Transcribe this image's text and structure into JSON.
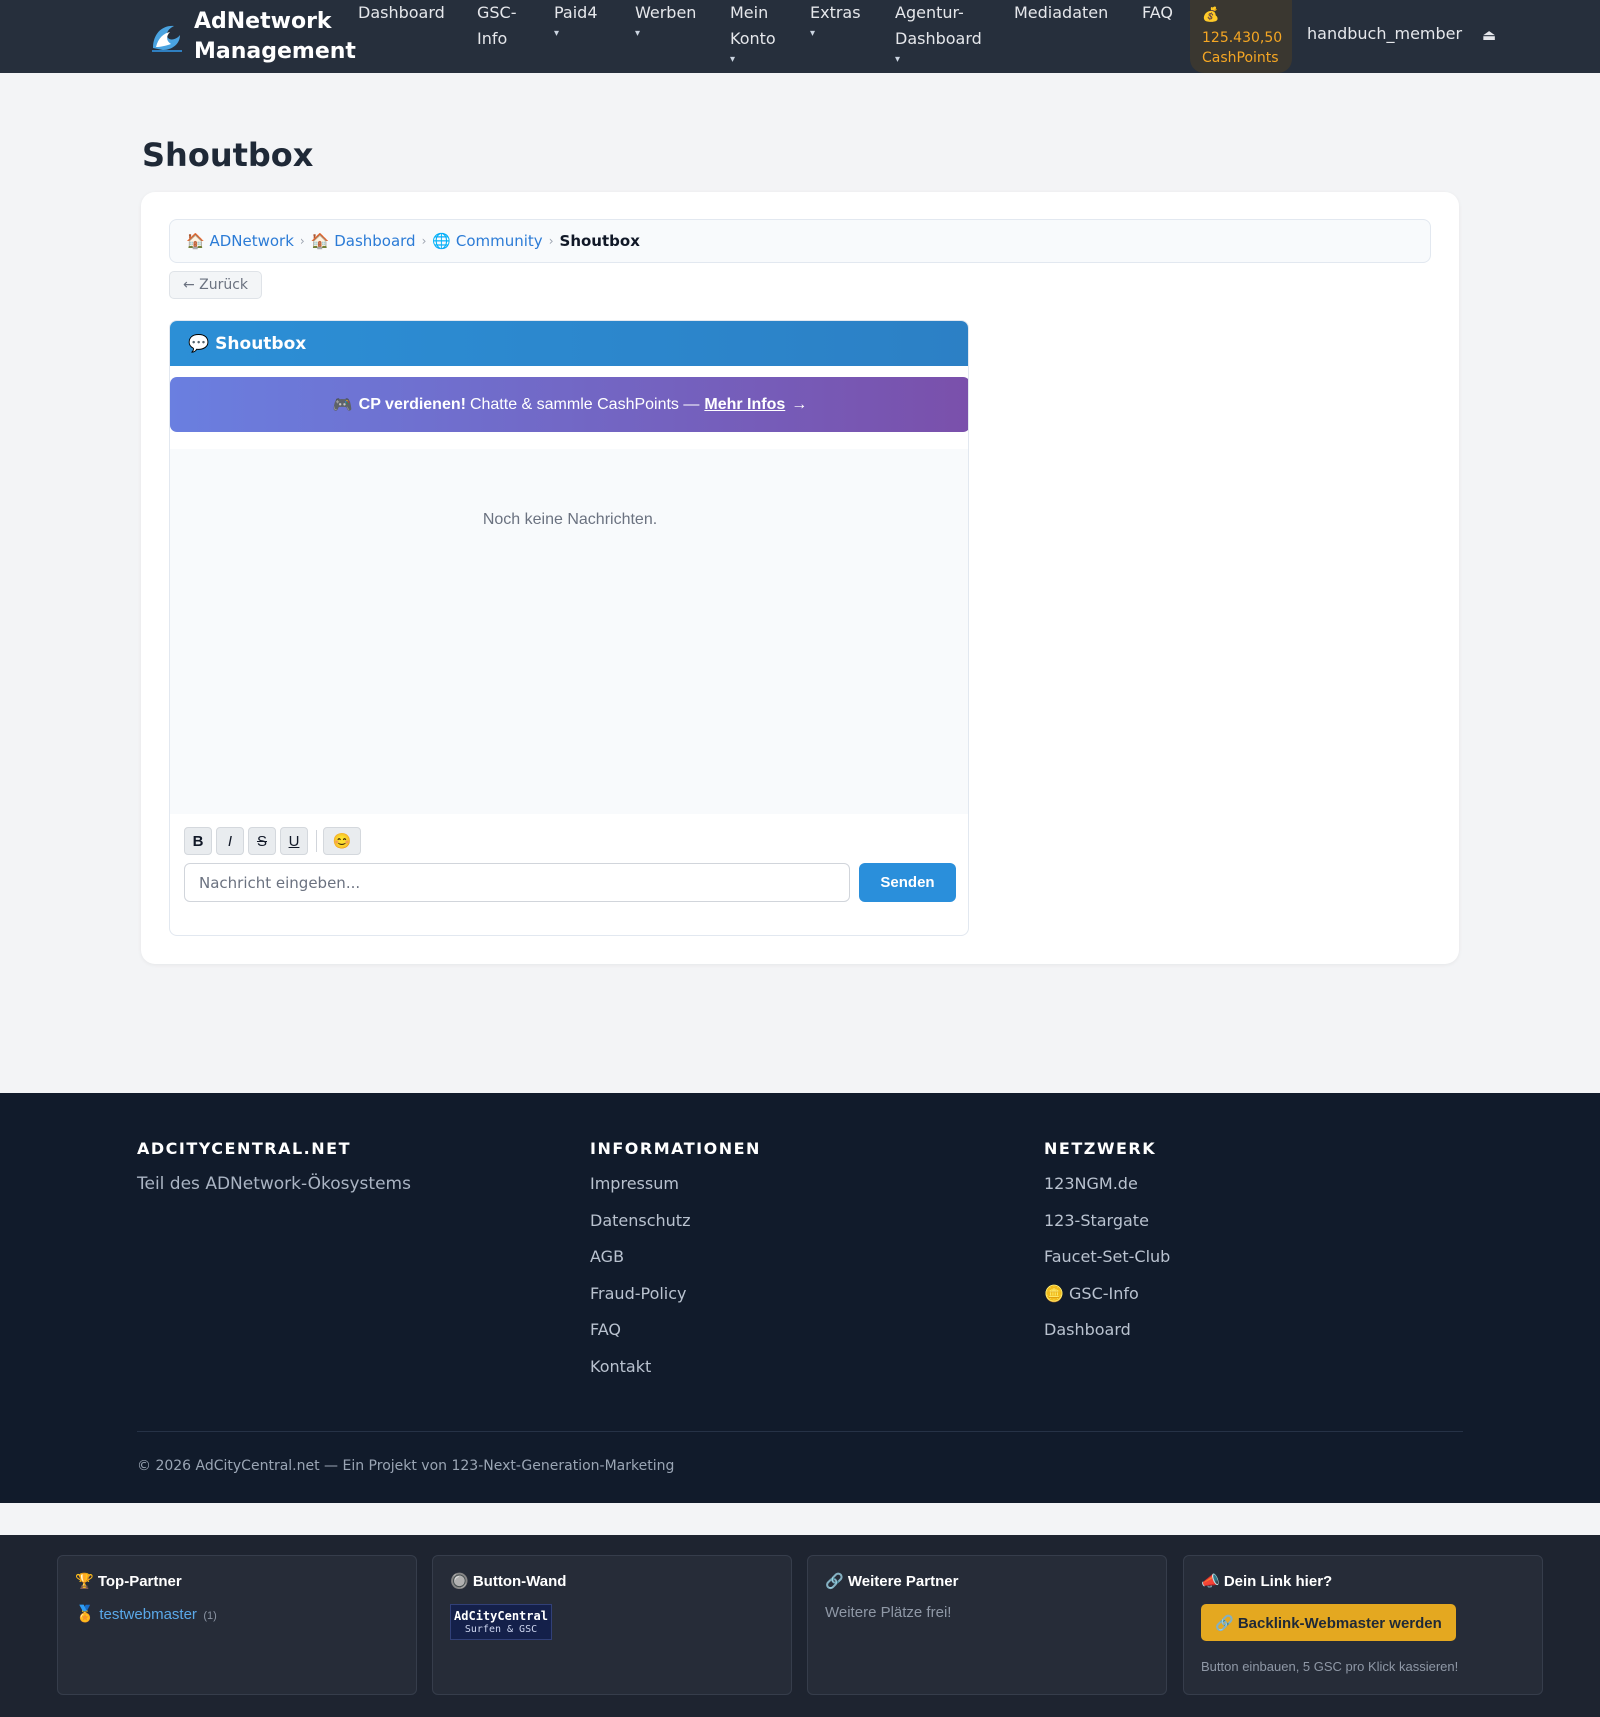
{
  "nav": {
    "brand": "AdNetwork Management",
    "items": [
      {
        "label": "Dashboard",
        "caret": ""
      },
      {
        "label": "GSC-Info",
        "caret": ""
      },
      {
        "label": "Paid4",
        "caret": "▾"
      },
      {
        "label": "Werben",
        "caret": "▾"
      },
      {
        "label": "Mein Konto",
        "caret": "▾"
      },
      {
        "label": "Extras",
        "caret": "▾"
      },
      {
        "label": "Agentur-Dashboard",
        "caret": "▾"
      },
      {
        "label": "Mediadaten",
        "caret": ""
      },
      {
        "label": "FAQ",
        "caret": ""
      }
    ],
    "cashpoints_icon": "💰",
    "cashpoints_value": "125.430,50",
    "cashpoints_unit": "CashPoints",
    "username": "handbuch_member",
    "logout_icon": "⏏"
  },
  "page": {
    "title": "Shoutbox"
  },
  "breadcrumb": {
    "items": [
      {
        "icon": "🏠",
        "label": "ADNetwork"
      },
      {
        "icon": "🏠",
        "label": "Dashboard"
      },
      {
        "icon": "🌐",
        "label": "Community"
      }
    ],
    "separator": "›",
    "current": "Shoutbox"
  },
  "back_button": "← Zurück",
  "shoutbox": {
    "header_icon": "💬",
    "header_title": "Shoutbox",
    "banner": {
      "icon": "🎮",
      "bold": "CP verdienen!",
      "text": "Chatte & sammle CashPoints —",
      "link": "Mehr Infos",
      "arrow": "→"
    },
    "empty_message": "Noch keine Nachrichten.",
    "toolbar": {
      "bold": "B",
      "italic": "I",
      "strike": "S",
      "underline": "U",
      "emoji": "😊"
    },
    "input_placeholder": "Nachricht eingeben...",
    "send_label": "Senden"
  },
  "footer": {
    "col1": {
      "heading": "ADCITYCENTRAL.NET",
      "text": "Teil des ADNetwork-Ökosystems"
    },
    "col2": {
      "heading": "INFORMATIONEN",
      "links": [
        "Impressum",
        "Datenschutz",
        "AGB",
        "Fraud-Policy",
        "FAQ",
        "Kontakt"
      ]
    },
    "col3": {
      "heading": "NETZWERK",
      "links": [
        "123NGM.de",
        "123-Stargate",
        "Faucet-Set-Club",
        "🪙 GSC-Info",
        "Dashboard"
      ]
    },
    "copyright": "© 2026 AdCityCentral.net — Ein Projekt von 123-Next-Generation-Marketing"
  },
  "partners": {
    "top": {
      "title": "🏆 Top-Partner",
      "medal": "🏅",
      "name": "testwebmaster",
      "count": "(1)"
    },
    "wall": {
      "title": "🔘 Button-Wand",
      "banner_line1": "AdCityCentral",
      "banner_line2": "Surfen & GSC"
    },
    "more": {
      "title": "🔗 Weitere Partner",
      "text": "Weitere Plätze frei!"
    },
    "yourlink": {
      "title": "📣 Dein Link hier?",
      "button": "🔗 Backlink-Webmaster werden",
      "note": "Button einbauen, 5 GSC pro Klick kassieren!"
    }
  },
  "colors": {
    "navbar": "#262f3c",
    "accent": "#2a8fdb",
    "cashpoints": "#f5a623",
    "footer": "#111b2b"
  }
}
